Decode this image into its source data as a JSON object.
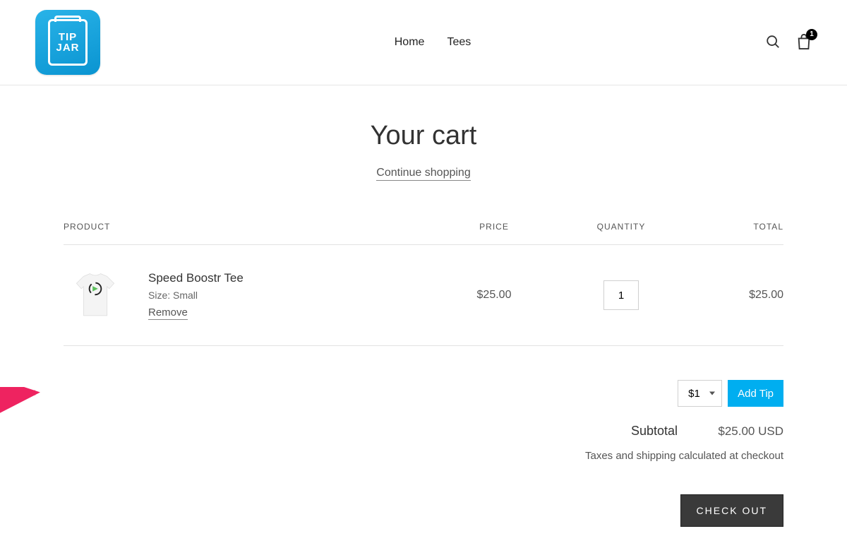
{
  "header": {
    "logo_line1": "TIP",
    "logo_line2": "JAR",
    "nav": {
      "home": "Home",
      "tees": "Tees"
    },
    "cart_count": "1"
  },
  "page": {
    "title": "Your cart",
    "continue_label": "Continue shopping"
  },
  "cart": {
    "columns": {
      "product": "PRODUCT",
      "price": "PRICE",
      "qty": "QUANTITY",
      "total": "TOTAL"
    },
    "item": {
      "name": "Speed Boostr Tee",
      "variant": "Size: Small",
      "remove_label": "Remove",
      "price": "$25.00",
      "qty": "1",
      "total": "$25.00"
    }
  },
  "tip": {
    "selected": "$1",
    "button_label": "Add Tip"
  },
  "summary": {
    "subtotal_label": "Subtotal",
    "subtotal_value": "$25.00 USD",
    "tax_note": "Taxes and shipping calculated at checkout",
    "checkout_label": "CHECK OUT"
  }
}
